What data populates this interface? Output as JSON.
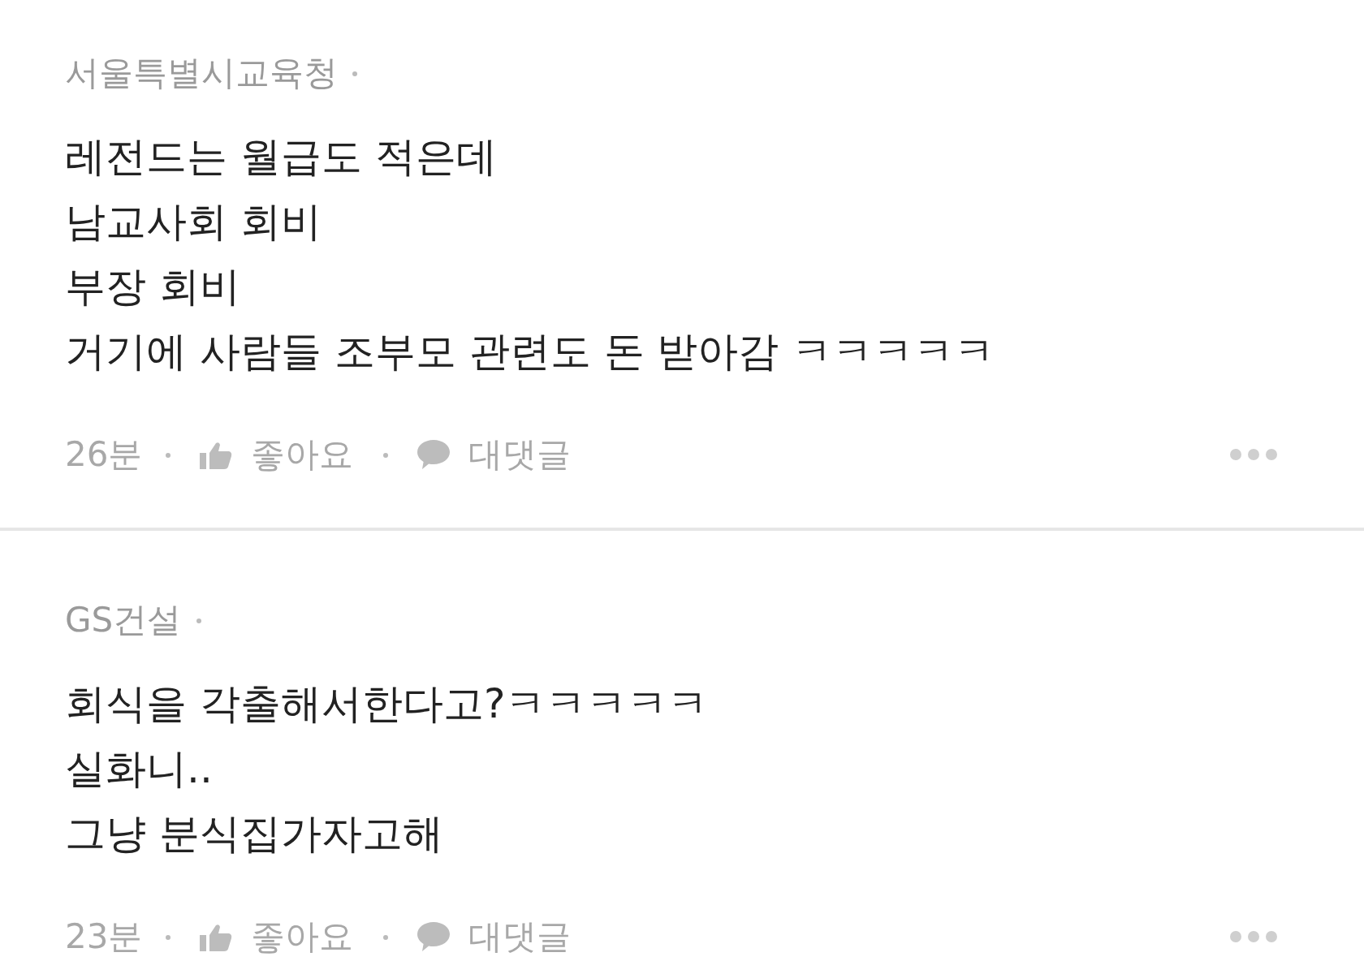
{
  "comments": [
    {
      "author": "서울특별시교육청",
      "body": "레전드는 월급도 적은데\n남교사회 회비\n부장 회비\n거기에 사람들 조부모 관련도 돈 받아감 ㅋㅋㅋㅋㅋ",
      "time": "26분",
      "like_label": "좋아요",
      "reply_label": "대댓글"
    },
    {
      "author": "GS건설",
      "body": "회식을 각출해서한다고?ㅋㅋㅋㅋㅋ\n실화니..\n그냥 분식집가자고해",
      "time": "23분",
      "like_label": "좋아요",
      "reply_label": "대댓글"
    }
  ]
}
